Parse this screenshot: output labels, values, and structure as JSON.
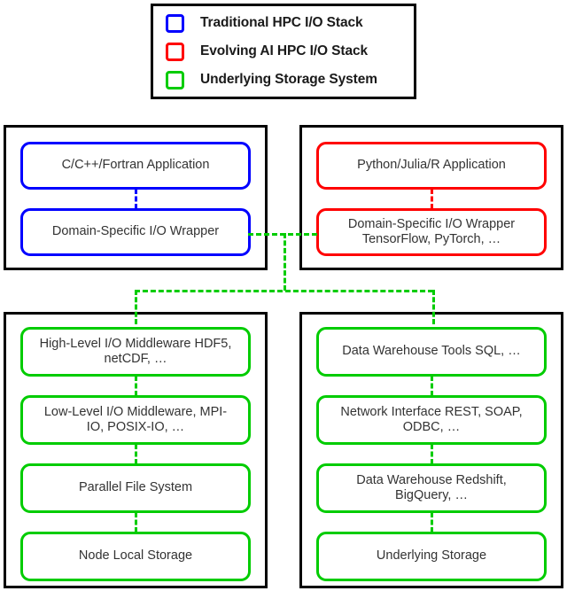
{
  "legend": {
    "items": [
      {
        "label": "Traditional HPC I/O Stack",
        "color": "#0000ff",
        "swatch_name": "legend-swatch-blue"
      },
      {
        "label": "Evolving AI HPC I/O Stack",
        "color": "#ff0000",
        "swatch_name": "legend-swatch-red"
      },
      {
        "label": "Underlying Storage System",
        "color": "#00cc00",
        "swatch_name": "legend-swatch-green"
      }
    ]
  },
  "panels": {
    "top_left": {
      "accent": "#0000ff",
      "nodes": [
        {
          "label": "C/C++/Fortran Application"
        },
        {
          "label": "Domain-Specific I/O Wrapper"
        }
      ]
    },
    "top_right": {
      "accent": "#ff0000",
      "nodes": [
        {
          "label": "Python/Julia/R Application"
        },
        {
          "label": "Domain-Specific I/O Wrapper\nTensorFlow, PyTorch, …"
        }
      ]
    },
    "bottom_left": {
      "accent": "#00cc00",
      "nodes": [
        {
          "label": "High-Level I/O Middleware HDF5,\nnetCDF, …"
        },
        {
          "label": "Low-Level I/O Middleware, MPI-\nIO, POSIX-IO, …"
        },
        {
          "label": "Parallel File System"
        },
        {
          "label": "Node Local Storage"
        }
      ]
    },
    "bottom_right": {
      "accent": "#00cc00",
      "nodes": [
        {
          "label": "Data Warehouse Tools SQL, …"
        },
        {
          "label": "Network Interface REST, SOAP,\nODBC,  …"
        },
        {
          "label": "Data Warehouse Redshift,\nBigQuery, …"
        },
        {
          "label": "Underlying Storage"
        }
      ]
    }
  },
  "colors": {
    "blue": "#0000ff",
    "red": "#ff0000",
    "green": "#00cc00",
    "outline": "#000000",
    "text": "#333333"
  }
}
